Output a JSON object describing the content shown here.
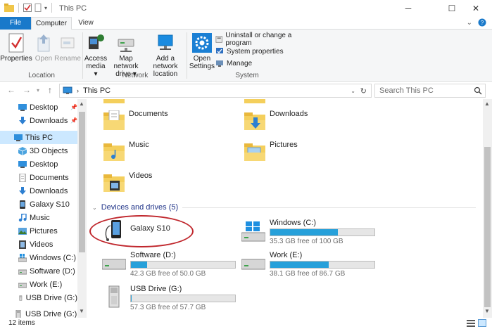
{
  "window": {
    "title": "This PC",
    "minimize_glyph": "─",
    "maximize_glyph": "☐",
    "close_glyph": "✕"
  },
  "ribbon_tabs": {
    "file": "File",
    "computer": "Computer",
    "view": "View"
  },
  "ribbon": {
    "location": {
      "label": "Location",
      "properties": "Properties",
      "open": "Open",
      "rename": "Rename"
    },
    "network": {
      "label": "Network",
      "access_media_1": "Access",
      "access_media_2": "media ▾",
      "map_drive_1": "Map network",
      "map_drive_2": "drive ▾",
      "add_location_1": "Add a network",
      "add_location_2": "location"
    },
    "system": {
      "label": "System",
      "open_settings_1": "Open",
      "open_settings_2": "Settings",
      "uninstall": "Uninstall or change a program",
      "system_properties": "System properties",
      "manage": "Manage"
    }
  },
  "address": {
    "path": "This PC",
    "search_placeholder": "Search This PC"
  },
  "nav_pane": [
    {
      "label": "Desktop",
      "pinned": true
    },
    {
      "label": "Downloads",
      "pinned": true
    },
    {
      "label": "This PC",
      "selected": true
    },
    {
      "label": "3D Objects"
    },
    {
      "label": "Desktop"
    },
    {
      "label": "Documents"
    },
    {
      "label": "Downloads"
    },
    {
      "label": "Galaxy S10"
    },
    {
      "label": "Music"
    },
    {
      "label": "Pictures"
    },
    {
      "label": "Videos"
    },
    {
      "label": "Windows (C:)"
    },
    {
      "label": "Software (D:)"
    },
    {
      "label": "Work (E:)"
    },
    {
      "label": "USB Drive (G:)"
    },
    {
      "label": "USB Drive (G:)"
    }
  ],
  "folders": [
    {
      "name": "Documents"
    },
    {
      "name": "Downloads"
    },
    {
      "name": "Music"
    },
    {
      "name": "Pictures"
    },
    {
      "name": "Videos"
    }
  ],
  "devices_header": "Devices and drives (5)",
  "drives": [
    {
      "name": "Galaxy S10"
    },
    {
      "name": "Windows (C:)",
      "free": "35.3 GB free of 100 GB",
      "used_fraction": 0.647
    },
    {
      "name": "Software (D:)",
      "free": "42.3 GB free of 50.0 GB",
      "used_fraction": 0.154
    },
    {
      "name": "Work (E:)",
      "free": "38.1 GB free of 86.7 GB",
      "used_fraction": 0.561
    },
    {
      "name": "USB Drive (G:)",
      "free": "57.3 GB free of 57.7 GB",
      "used_fraction": 0.007
    }
  ],
  "status": {
    "items": "12 items"
  },
  "colors": {
    "accent": "#1979ca",
    "selection": "#cce8ff",
    "bar_fill": "#26a0da",
    "annotation": "#c0272d"
  }
}
